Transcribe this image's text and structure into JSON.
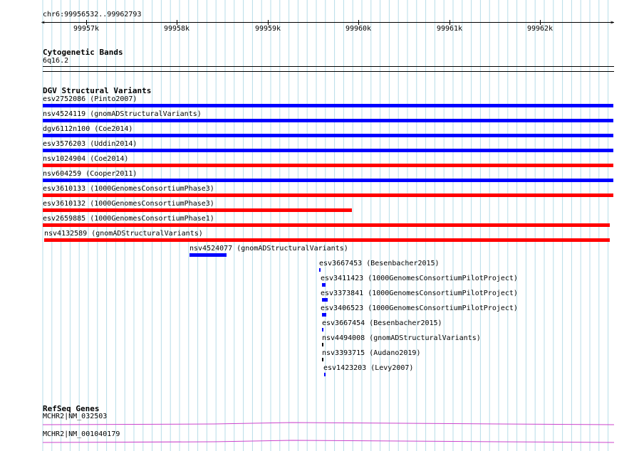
{
  "ruler": {
    "region": "chr6:99956532..99962793",
    "ticks": [
      "99957k",
      "99958k",
      "99959k",
      "99960k",
      "99961k",
      "99962k"
    ]
  },
  "tracks": {
    "cytobands": {
      "title": "Cytogenetic Bands",
      "band": "6q16.2"
    },
    "dgv": {
      "title": "DGV Structural Variants",
      "features": [
        {
          "label": "esv2752086 (Pinto2007)",
          "color": "#0000ff"
        },
        {
          "label": "nsv4524119 (gnomADStructuralVariants)",
          "color": "#0000ff"
        },
        {
          "label": "dgv6112n100 (Coe2014)",
          "color": "#0000ff"
        },
        {
          "label": "esv3576203 (Uddin2014)",
          "color": "#0000ff"
        },
        {
          "label": "nsv1024904 (Coe2014)",
          "color": "#ff0000"
        },
        {
          "label": "nsv604259 (Cooper2011)",
          "color": "#0000ff"
        },
        {
          "label": "esv3610133 (1000GenomesConsortiumPhase3)",
          "color": "#ff0000"
        },
        {
          "label": "esv3610132 (1000GenomesConsortiumPhase3)",
          "color": "#ff0000"
        },
        {
          "label": "esv2659885 (1000GenomesConsortiumPhase1)",
          "color": "#ff0000"
        },
        {
          "label": "nsv4132589 (gnomADStructuralVariants)",
          "color": "#ff0000"
        },
        {
          "label": "nsv4524077 (gnomADStructuralVariants)",
          "color": "#0000ff"
        },
        {
          "label": "esv3667453 (Besenbacher2015)",
          "color": "#0000ff"
        },
        {
          "label": "esv3411423 (1000GenomesConsortiumPilotProject)",
          "color": "#0000ff"
        },
        {
          "label": "esv3373841 (1000GenomesConsortiumPilotProject)",
          "color": "#0000ff"
        },
        {
          "label": "esv3406523 (1000GenomesConsortiumPilotProject)",
          "color": "#0000ff"
        },
        {
          "label": "esv3667454 (Besenbacher2015)",
          "color": "#0000ff"
        },
        {
          "label": "nsv4494008 (gnomADStructuralVariants)",
          "color": "#000000"
        },
        {
          "label": "nsv3393715 (Audano2019)",
          "color": "#000000"
        },
        {
          "label": "esv1423203 (Levy2007)",
          "color": "#0000ff"
        }
      ]
    },
    "refseq": {
      "title": "RefSeq Genes",
      "transcripts": [
        {
          "label": "MCHR2|NM_032503",
          "color": "#cc44cc"
        },
        {
          "label": "MCHR2|NM_001040179",
          "color": "#cc44cc"
        }
      ]
    }
  }
}
